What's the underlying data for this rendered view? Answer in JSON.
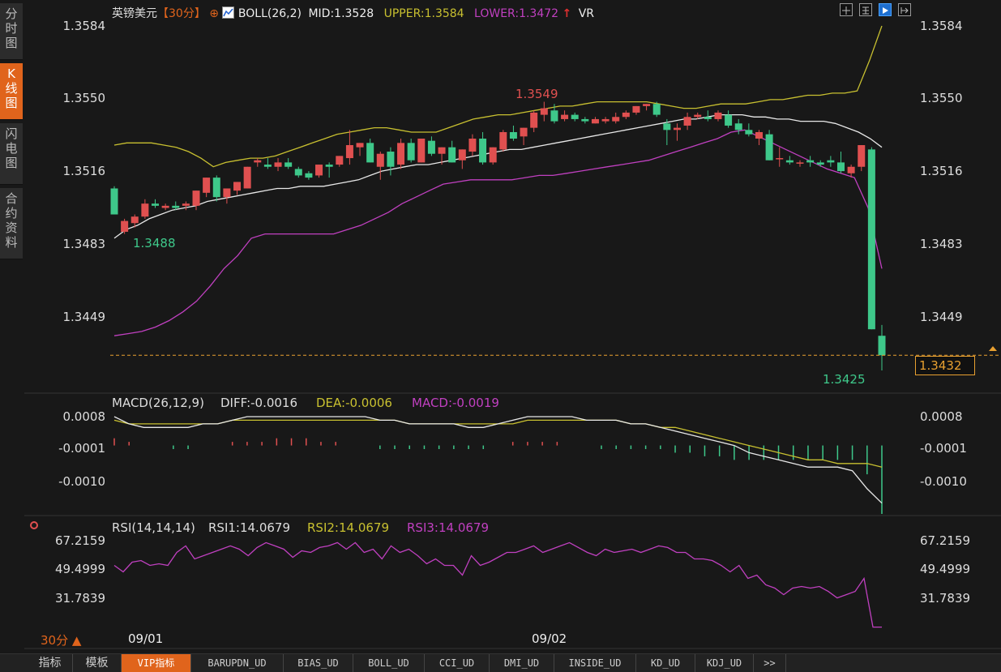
{
  "sidebar": {
    "tabs": [
      {
        "label": "分时图",
        "active": false
      },
      {
        "label": "K线图",
        "active": true
      },
      {
        "label": "闪电图",
        "active": false
      },
      {
        "label": "合约资料",
        "active": false
      }
    ]
  },
  "header": {
    "symbol": "英镑美元",
    "period": "【30分】",
    "indicator": "BOLL(26,2)",
    "mid": "MID:1.3528",
    "upper": "UPPER:1.3584",
    "lower": "LOWER:1.3472",
    "vr": "VR"
  },
  "colors": {
    "up": "#e05050",
    "down": "#3ec88a",
    "mid": "#e8e8e8",
    "upper": "#c8c030",
    "lower": "#c040c0",
    "accent": "#e0641c",
    "price_line": "#e8a030"
  },
  "current_price": "1.3432",
  "bottom_tabs": [
    "指标",
    "模板",
    "VIP指标",
    "BARUPDN_UD",
    "BIAS_UD",
    "BOLL_UD",
    "CCI_UD",
    "DMI_UD",
    "INSIDE_UD",
    "KD_UD",
    "KDJ_UD",
    ">>"
  ],
  "period_label": "30分 ▲",
  "chart_data": [
    {
      "type": "candlestick",
      "title": "英镑美元【30分】 BOLL(26,2)",
      "x_labels": [
        "09/01",
        "09/02"
      ],
      "y_ticks": [
        "1.3584",
        "1.3550",
        "1.3516",
        "1.3483",
        "1.3449"
      ],
      "ylim": [
        1.3425,
        1.3584
      ],
      "annotations": {
        "high": "1.3549",
        "low_left": "1.3488",
        "low_right": "1.3425"
      },
      "candles": [
        [
          1.3509,
          1.351,
          1.3497,
          1.3497
        ],
        [
          1.3489,
          1.3495,
          1.3488,
          1.3494
        ],
        [
          1.3493,
          1.3497,
          1.3491,
          1.3496
        ],
        [
          1.3496,
          1.3504,
          1.3495,
          1.3502
        ],
        [
          1.3502,
          1.3504,
          1.35,
          1.3501
        ],
        [
          1.35,
          1.3502,
          1.3499,
          1.3501
        ],
        [
          1.3501,
          1.3503,
          1.3499,
          1.35
        ],
        [
          1.3501,
          1.3503,
          1.3499,
          1.3502
        ],
        [
          1.3501,
          1.3508,
          1.3499,
          1.3508
        ],
        [
          1.3507,
          1.3514,
          1.3505,
          1.3514
        ],
        [
          1.3514,
          1.3515,
          1.3503,
          1.3505
        ],
        [
          1.3505,
          1.3508,
          1.3502,
          1.3509
        ],
        [
          1.3508,
          1.3512,
          1.3506,
          1.3512
        ],
        [
          1.3509,
          1.3519,
          1.3509,
          1.3519
        ],
        [
          1.3521,
          1.3523,
          1.3519,
          1.3522
        ],
        [
          1.352,
          1.3523,
          1.3518,
          1.3519
        ],
        [
          1.3519,
          1.3523,
          1.3517,
          1.3521
        ],
        [
          1.3521,
          1.3523,
          1.3518,
          1.3519
        ],
        [
          1.3518,
          1.3519,
          1.3514,
          1.3515
        ],
        [
          1.3516,
          1.3517,
          1.3513,
          1.3514
        ],
        [
          1.3515,
          1.352,
          1.3514,
          1.352
        ],
        [
          1.352,
          1.3521,
          1.3514,
          1.3519
        ],
        [
          1.352,
          1.3524,
          1.3519,
          1.3524
        ],
        [
          1.3523,
          1.3536,
          1.352,
          1.3529
        ],
        [
          1.3528,
          1.353,
          1.3524,
          1.353
        ],
        [
          1.353,
          1.3532,
          1.3521,
          1.3521
        ],
        [
          1.3519,
          1.3526,
          1.3513,
          1.3525
        ],
        [
          1.3526,
          1.3528,
          1.3515,
          1.3519
        ],
        [
          1.352,
          1.3532,
          1.3518,
          1.353
        ],
        [
          1.353,
          1.3532,
          1.3521,
          1.3522
        ],
        [
          1.3521,
          1.3532,
          1.3521,
          1.3532
        ],
        [
          1.3531,
          1.3533,
          1.3524,
          1.3525
        ],
        [
          1.3525,
          1.3528,
          1.352,
          1.3528
        ],
        [
          1.3528,
          1.3531,
          1.3521,
          1.3521
        ],
        [
          1.3522,
          1.3527,
          1.3518,
          1.3527
        ],
        [
          1.3526,
          1.3534,
          1.3524,
          1.3532
        ],
        [
          1.3532,
          1.3535,
          1.352,
          1.3521
        ],
        [
          1.3521,
          1.3528,
          1.352,
          1.3528
        ],
        [
          1.3527,
          1.3536,
          1.3526,
          1.3535
        ],
        [
          1.3535,
          1.3538,
          1.3531,
          1.3532
        ],
        [
          1.3533,
          1.3537,
          1.3529,
          1.3537
        ],
        [
          1.3537,
          1.3545,
          1.3535,
          1.3544
        ],
        [
          1.3543,
          1.3549,
          1.354,
          1.3546
        ],
        [
          1.3545,
          1.3548,
          1.3539,
          1.354
        ],
        [
          1.3541,
          1.3545,
          1.354,
          1.3543
        ],
        [
          1.3543,
          1.3544,
          1.354,
          1.3541
        ],
        [
          1.3541,
          1.3542,
          1.3539,
          1.354
        ],
        [
          1.3539,
          1.3542,
          1.3539,
          1.3541
        ],
        [
          1.354,
          1.3542,
          1.3539,
          1.3541
        ],
        [
          1.354,
          1.3544,
          1.3539,
          1.3542
        ],
        [
          1.3542,
          1.3545,
          1.3541,
          1.3544
        ],
        [
          1.3544,
          1.3547,
          1.3543,
          1.3547
        ],
        [
          1.3547,
          1.3548,
          1.3545,
          1.3548
        ],
        [
          1.3548,
          1.3549,
          1.3542,
          1.3543
        ],
        [
          1.3539,
          1.3541,
          1.3529,
          1.3536
        ],
        [
          1.3536,
          1.3539,
          1.3531,
          1.3537
        ],
        [
          1.3538,
          1.3544,
          1.3536,
          1.3542
        ],
        [
          1.3542,
          1.3544,
          1.3541,
          1.3543
        ],
        [
          1.3542,
          1.3545,
          1.354,
          1.3541
        ],
        [
          1.3541,
          1.3545,
          1.354,
          1.3544
        ],
        [
          1.3543,
          1.3545,
          1.3537,
          1.3538
        ],
        [
          1.3539,
          1.3541,
          1.3534,
          1.3536
        ],
        [
          1.3536,
          1.3539,
          1.3533,
          1.3534
        ],
        [
          1.3532,
          1.3536,
          1.3529,
          1.3535
        ],
        [
          1.3534,
          1.3536,
          1.3522,
          1.3522
        ],
        [
          1.3523,
          1.3528,
          1.3519,
          1.3523
        ],
        [
          1.3522,
          1.3524,
          1.352,
          1.3521
        ],
        [
          1.3521,
          1.3522,
          1.3519,
          1.3521
        ],
        [
          1.3522,
          1.3524,
          1.3519,
          1.3521
        ],
        [
          1.3521,
          1.3522,
          1.3519,
          1.352
        ],
        [
          1.3522,
          1.3524,
          1.3519,
          1.3521
        ],
        [
          1.3521,
          1.3526,
          1.3516,
          1.3517
        ],
        [
          1.3516,
          1.352,
          1.3514,
          1.3519
        ],
        [
          1.3519,
          1.3529,
          1.3517,
          1.3529
        ],
        [
          1.3527,
          1.3528,
          1.3444,
          1.3444
        ],
        [
          1.3441,
          1.3446,
          1.3425,
          1.3432
        ]
      ],
      "boll_mid": [
        1.3486,
        1.349,
        1.3492,
        1.3495,
        1.3497,
        1.3499,
        1.35,
        1.3501,
        1.3503,
        1.3504,
        1.3505,
        1.3506,
        1.3507,
        1.3508,
        1.3509,
        1.3509,
        1.351,
        1.351,
        1.351,
        1.3511,
        1.3512,
        1.3513,
        1.3515,
        1.3517,
        1.3518,
        1.3519,
        1.352,
        1.352,
        1.3521,
        1.3522,
        1.3523,
        1.3524,
        1.3525,
        1.3526,
        1.3527,
        1.3527,
        1.3528,
        1.3529,
        1.353,
        1.3531,
        1.3532,
        1.3533,
        1.3534,
        1.3535,
        1.3536,
        1.3537,
        1.3538,
        1.3539,
        1.354,
        1.3541,
        1.3541,
        1.3542,
        1.3543,
        1.3543,
        1.3543,
        1.3542,
        1.3542,
        1.3541,
        1.3541,
        1.354,
        1.354,
        1.354,
        1.3539,
        1.3537,
        1.3535,
        1.3532,
        1.3528
      ],
      "boll_upper": [
        1.3529,
        1.353,
        1.353,
        1.353,
        1.3529,
        1.3528,
        1.3526,
        1.3523,
        1.3519,
        1.3521,
        1.3522,
        1.3523,
        1.3523,
        1.3524,
        1.3526,
        1.3528,
        1.353,
        1.3532,
        1.3534,
        1.3535,
        1.3536,
        1.3537,
        1.3537,
        1.3536,
        1.3535,
        1.3535,
        1.3535,
        1.3537,
        1.3539,
        1.3541,
        1.3542,
        1.3543,
        1.3543,
        1.3544,
        1.3545,
        1.3546,
        1.3547,
        1.3547,
        1.3548,
        1.3549,
        1.3549,
        1.3549,
        1.3549,
        1.3549,
        1.3548,
        1.3547,
        1.3546,
        1.3546,
        1.3547,
        1.3548,
        1.3548,
        1.3548,
        1.3549,
        1.355,
        1.355,
        1.3551,
        1.3552,
        1.3552,
        1.3553,
        1.3553,
        1.3554,
        1.3568,
        1.3584
      ],
      "boll_lower": [
        1.3441,
        1.3442,
        1.3443,
        1.3445,
        1.3448,
        1.3452,
        1.3457,
        1.3464,
        1.3472,
        1.3478,
        1.3486,
        1.3488,
        1.3488,
        1.3488,
        1.3488,
        1.3488,
        1.3488,
        1.349,
        1.3492,
        1.3495,
        1.3498,
        1.3502,
        1.3505,
        1.3508,
        1.3511,
        1.3512,
        1.3513,
        1.3513,
        1.3513,
        1.3513,
        1.3514,
        1.3515,
        1.3515,
        1.3516,
        1.3517,
        1.3518,
        1.3519,
        1.352,
        1.3521,
        1.3522,
        1.3524,
        1.3526,
        1.3528,
        1.353,
        1.3532,
        1.3535,
        1.3536,
        1.3533,
        1.353,
        1.3527,
        1.3524,
        1.3521,
        1.3518,
        1.3516,
        1.3514,
        1.35,
        1.3472
      ]
    },
    {
      "type": "macd",
      "title": "MACD(26,12,9)",
      "labels": {
        "diff": "DIFF:-0.0016",
        "dea": "DEA:-0.0006",
        "macd": "MACD:-0.0019"
      },
      "y_ticks": [
        "0.0008",
        "-0.0001",
        "-0.0010"
      ],
      "ylim": [
        -0.0018,
        0.0009
      ],
      "diff": [
        0.0008,
        0.0006,
        0.0005,
        0.0005,
        0.0005,
        0.0005,
        0.0006,
        0.0006,
        0.0007,
        0.0008,
        0.0008,
        0.0008,
        0.0008,
        0.0008,
        0.0008,
        0.0008,
        0.0008,
        0.0008,
        0.0007,
        0.0007,
        0.0006,
        0.0006,
        0.0006,
        0.0006,
        0.0005,
        0.0005,
        0.0006,
        0.0007,
        0.0008,
        0.0008,
        0.0008,
        0.0008,
        0.0007,
        0.0007,
        0.0007,
        0.0006,
        0.0006,
        0.0005,
        0.0004,
        0.0003,
        0.0002,
        0.0001,
        0.0,
        -0.0002,
        -0.0003,
        -0.0004,
        -0.0005,
        -0.0006,
        -0.0006,
        -0.0006,
        -0.0007,
        -0.0012,
        -0.0016
      ],
      "dea": [
        0.0007,
        0.0006,
        0.0006,
        0.0006,
        0.0006,
        0.0006,
        0.0006,
        0.0006,
        0.0007,
        0.0007,
        0.0007,
        0.0007,
        0.0007,
        0.0007,
        0.0007,
        0.0007,
        0.0007,
        0.0007,
        0.0007,
        0.0007,
        0.0006,
        0.0006,
        0.0006,
        0.0006,
        0.0006,
        0.0006,
        0.0006,
        0.0006,
        0.0007,
        0.0007,
        0.0007,
        0.0007,
        0.0007,
        0.0007,
        0.0007,
        0.0006,
        0.0006,
        0.0005,
        0.0005,
        0.0004,
        0.0003,
        0.0002,
        0.0001,
        0.0,
        -0.0001,
        -0.0002,
        -0.0003,
        -0.0004,
        -0.0004,
        -0.0005,
        -0.0005,
        -0.0005,
        -0.0006
      ],
      "hist": [
        0.0002,
        0.0001,
        0.0,
        0.0,
        -0.0001,
        -0.0001,
        0.0,
        0.0,
        0.0001,
        0.0001,
        0.0001,
        0.0002,
        0.0002,
        0.0002,
        0.0001,
        0.0001,
        0.0,
        0.0,
        -0.0001,
        -0.0001,
        -0.0001,
        -0.0001,
        -0.0001,
        -0.0001,
        -0.0001,
        -0.0001,
        0.0,
        0.0001,
        0.0001,
        0.0001,
        0.0001,
        0.0,
        0.0,
        -0.0001,
        -0.0001,
        -0.0001,
        -0.0001,
        -0.0001,
        -0.0002,
        -0.0002,
        -0.0003,
        -0.0003,
        -0.0004,
        -0.0004,
        -0.0004,
        -0.0004,
        -0.0004,
        -0.0004,
        -0.0004,
        -0.0004,
        -0.0004,
        -0.0008,
        -0.0019
      ]
    },
    {
      "type": "rsi",
      "title": "RSI(14,14,14)",
      "labels": {
        "rsi1": "RSI1:14.0679",
        "rsi2": "RSI2:14.0679",
        "rsi3": "RSI3:14.0679"
      },
      "y_ticks": [
        "67.2159",
        "49.4999",
        "31.7839"
      ],
      "ylim": [
        10,
        72
      ],
      "rsi": [
        52,
        48,
        54,
        55,
        52,
        53,
        52,
        60,
        64,
        56,
        58,
        60,
        62,
        64,
        62,
        58,
        63,
        66,
        64,
        62,
        57,
        61,
        60,
        63,
        64,
        66,
        62,
        66,
        60,
        62,
        56,
        64,
        60,
        62,
        58,
        53,
        56,
        52,
        52,
        46,
        58,
        52,
        54,
        57,
        60,
        60,
        62,
        64,
        60,
        62,
        64,
        66,
        63,
        60,
        58,
        62,
        60,
        61,
        62,
        60,
        62,
        64,
        63,
        60,
        60,
        56,
        56,
        55,
        52,
        48,
        52,
        44,
        46,
        40,
        38,
        34,
        38,
        39,
        38,
        39,
        36,
        32,
        34,
        36,
        44,
        14,
        14
      ]
    }
  ]
}
